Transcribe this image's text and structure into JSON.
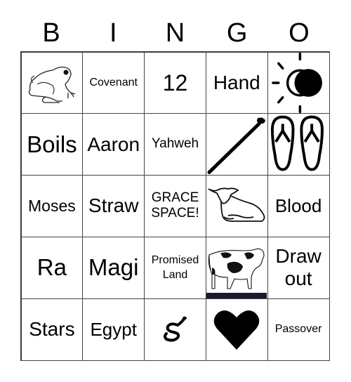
{
  "header": {
    "letters": [
      "B",
      "I",
      "N",
      "G",
      "O"
    ]
  },
  "cells": [
    [
      "frog-image",
      "Covenant",
      "12",
      "Hand",
      "sun-moon-image"
    ],
    [
      "Boils",
      "Aaron",
      "Yahweh",
      "staff-image",
      "sandals-image"
    ],
    [
      "Moses",
      "Straw",
      "GRACE SPACE!",
      "lamb-image",
      "Blood"
    ],
    [
      "Ra",
      "Magi",
      "Promised Land",
      "cow-image",
      "Draw out"
    ],
    [
      "Stars",
      "Egypt",
      "snake-image",
      "heart-image",
      "Passover"
    ]
  ],
  "text": {
    "covenant": "Covenant",
    "twelve": "12",
    "hand": "Hand",
    "boils": "Boils",
    "aaron": "Aaron",
    "yahweh": "Yahweh",
    "moses": "Moses",
    "straw": "Straw",
    "grace_line1": "GRACE",
    "grace_line2": "SPACE!",
    "blood": "Blood",
    "ra": "Ra",
    "magi": "Magi",
    "promised_line1": "Promised",
    "promised_line2": "Land",
    "draw_line1": "Draw",
    "draw_line2": "out",
    "stars": "Stars",
    "egypt": "Egypt",
    "passover": "Passover"
  }
}
